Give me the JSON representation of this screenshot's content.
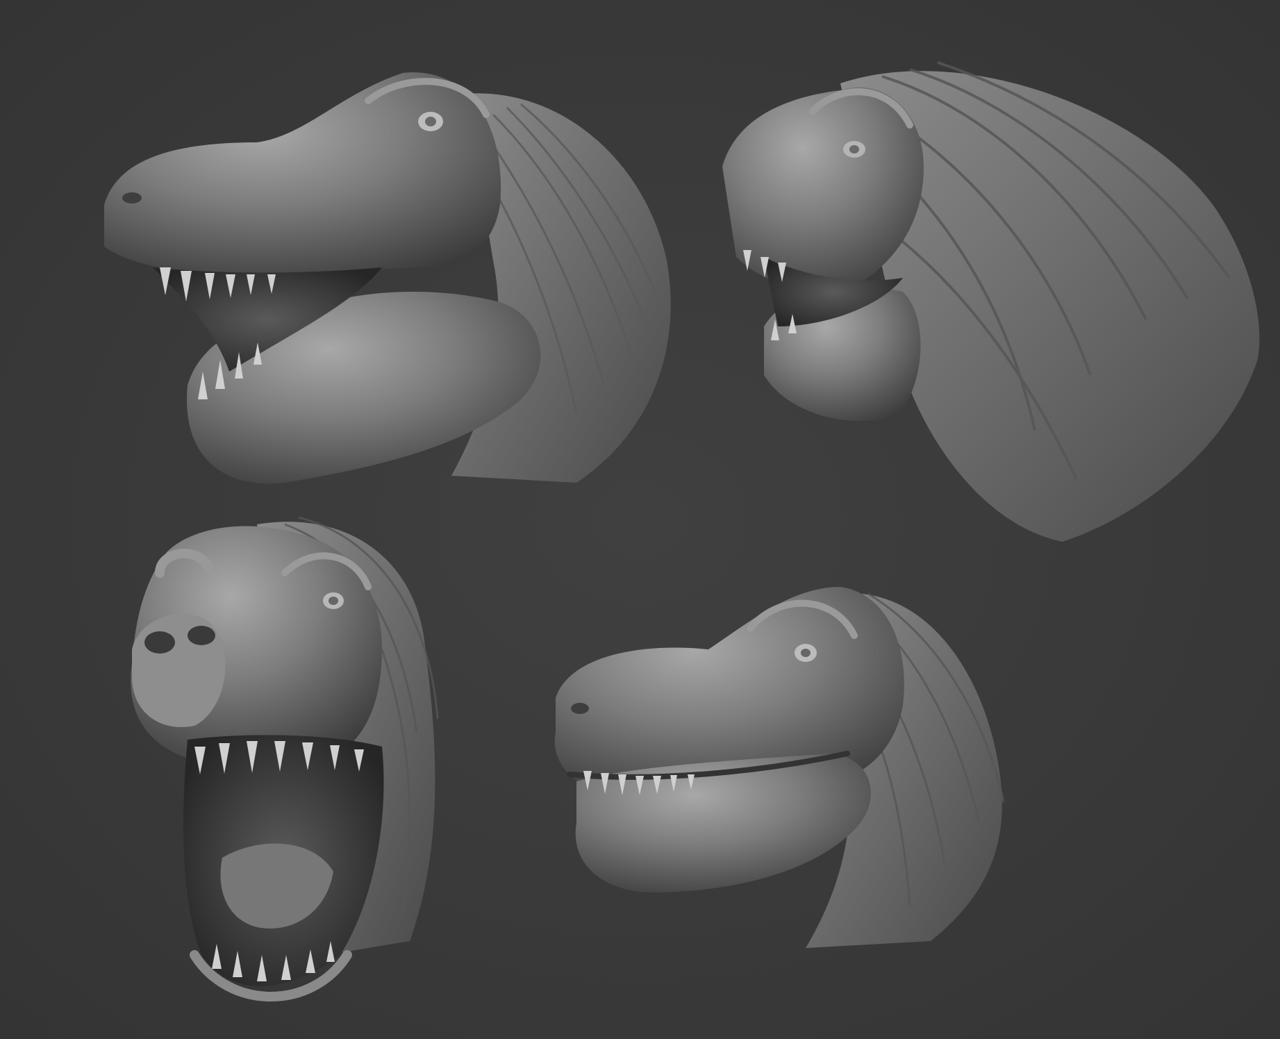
{
  "scene": {
    "background_color": "#3b3b3b",
    "clay_color": "#7a7a7a",
    "clay_highlight": "#a9a9a9",
    "clay_shadow": "#2a2a2a"
  },
  "views": [
    {
      "name": "left-profile",
      "mouth": "open"
    },
    {
      "name": "right-three-quarter-back",
      "mouth": "open"
    },
    {
      "name": "front-three-quarter",
      "mouth": "open"
    },
    {
      "name": "left-three-quarter",
      "mouth": "closed"
    }
  ]
}
